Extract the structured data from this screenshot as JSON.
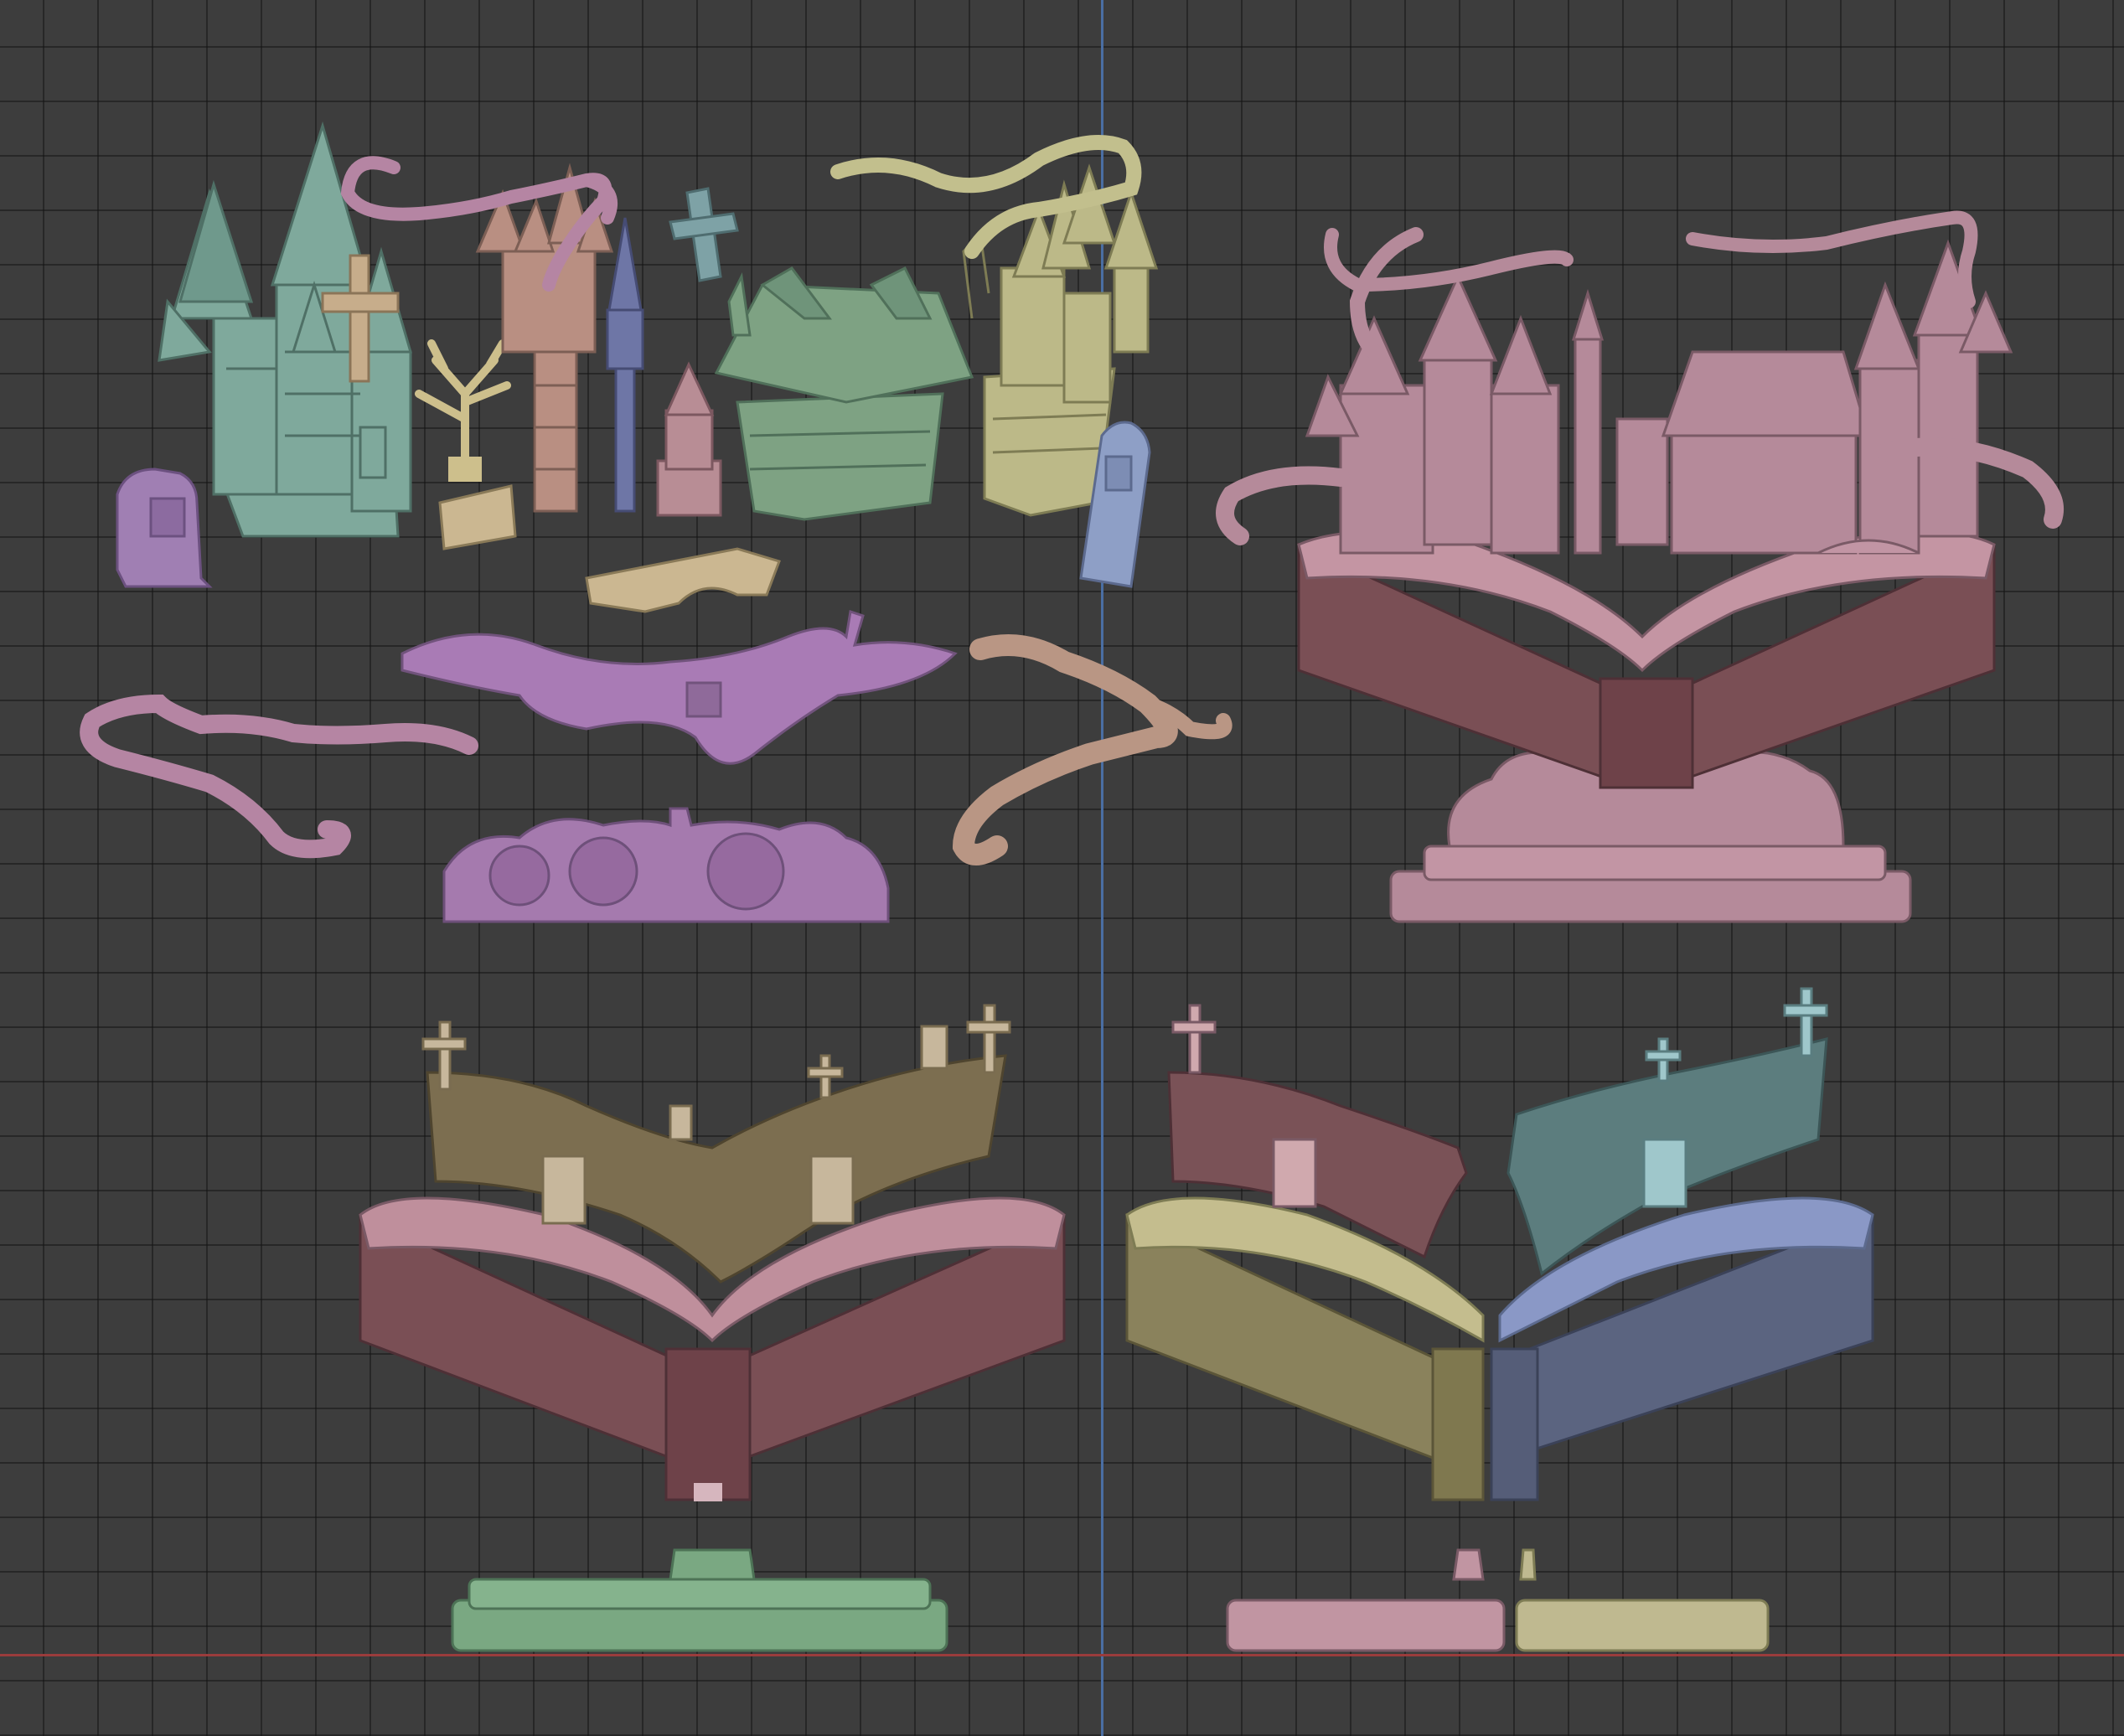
{
  "viewport": {
    "background_color": "#3d3d3d",
    "grid_color": "#242424",
    "y_axis_color": "#4a6ea3",
    "x_axis_color": "#9a3c3c"
  },
  "objects": [
    {
      "name": "castle-teal",
      "color": "#7fa99c"
    },
    {
      "name": "tombstone-purple",
      "color": "#a07fb3"
    },
    {
      "name": "cross-tan",
      "color": "#c7ad8b"
    },
    {
      "name": "tree-dead",
      "color": "#cdbf8c"
    },
    {
      "name": "castle-tower-brown",
      "color": "#b98f82"
    },
    {
      "name": "spire-blue",
      "color": "#6e76a6"
    },
    {
      "name": "small-tower-mauve",
      "color": "#b88d95"
    },
    {
      "name": "house-green",
      "color": "#7ea283"
    },
    {
      "name": "castle-yellow",
      "color": "#bcb988"
    },
    {
      "name": "tombstone-blue",
      "color": "#8e9fc6"
    },
    {
      "name": "bridge-tan",
      "color": "#cbb791"
    },
    {
      "name": "ground-purple",
      "color": "#a97bb5"
    },
    {
      "name": "clouds-purple",
      "color": "#a57aae"
    },
    {
      "name": "vine-pink",
      "color": "#b585a3"
    },
    {
      "name": "vine-tan",
      "color": "#b99684"
    },
    {
      "name": "assembled-model",
      "color": "#b58a9a"
    },
    {
      "name": "book-cover",
      "color": "#7a4f55"
    },
    {
      "name": "book-pages-pink",
      "color": "#bf8f9c"
    },
    {
      "name": "page-scene-olive",
      "color": "#7c6e50"
    },
    {
      "name": "base-green",
      "color": "#7aa882"
    },
    {
      "name": "split-olive",
      "color": "#8a825c"
    },
    {
      "name": "split-teal",
      "color": "#5c7d7e"
    },
    {
      "name": "split-blue",
      "color": "#5b6480"
    }
  ]
}
